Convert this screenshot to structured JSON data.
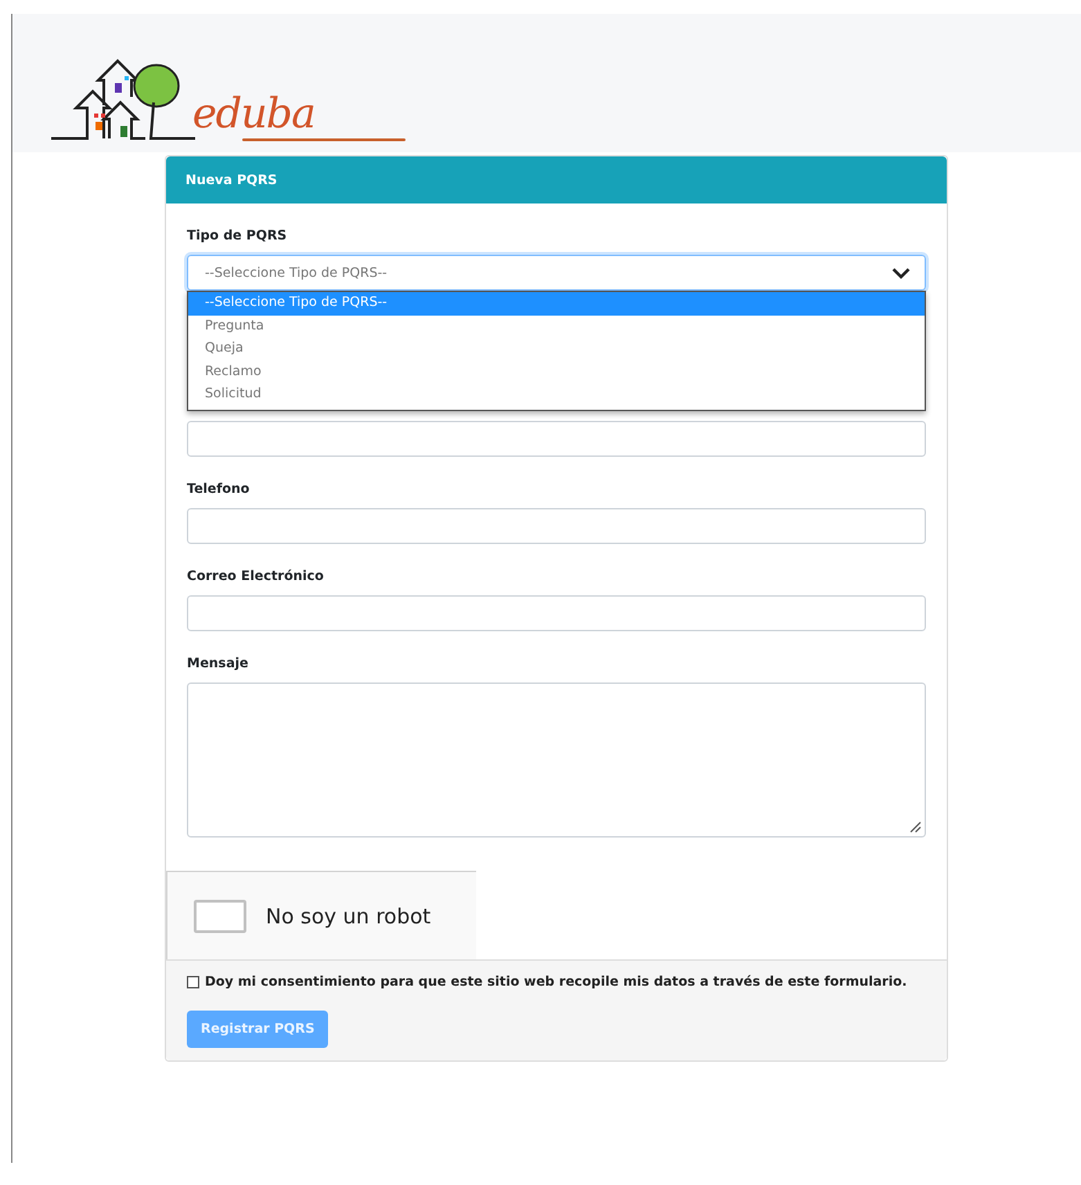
{
  "logo": {
    "text": "eduba"
  },
  "card": {
    "title": "Nueva PQRS"
  },
  "select": {
    "label": "Tipo de PQRS",
    "value": "--Seleccione Tipo de PQRS--",
    "expanded": true,
    "options": [
      {
        "label": "--Seleccione Tipo de PQRS--",
        "selected": true
      },
      {
        "label": "Pregunta",
        "selected": false
      },
      {
        "label": "Queja",
        "selected": false
      },
      {
        "label": "Reclamo",
        "selected": false
      },
      {
        "label": "Solicitud",
        "selected": false
      }
    ]
  },
  "fields": [
    {
      "kind": "text"
    },
    {
      "kind": "text",
      "label": "Telefono"
    },
    {
      "kind": "text",
      "label": "Correo Electrónico"
    },
    {
      "kind": "textarea",
      "label": "Mensaje"
    }
  ],
  "captcha": {
    "text": "No soy un robot",
    "checked": false
  },
  "consent": {
    "text": "Doy mi consentimiento para que este sitio web recopile mis datos a través de este formulario.",
    "checked": false
  },
  "submit": {
    "label": "Registrar PQRS",
    "disabled": true
  }
}
